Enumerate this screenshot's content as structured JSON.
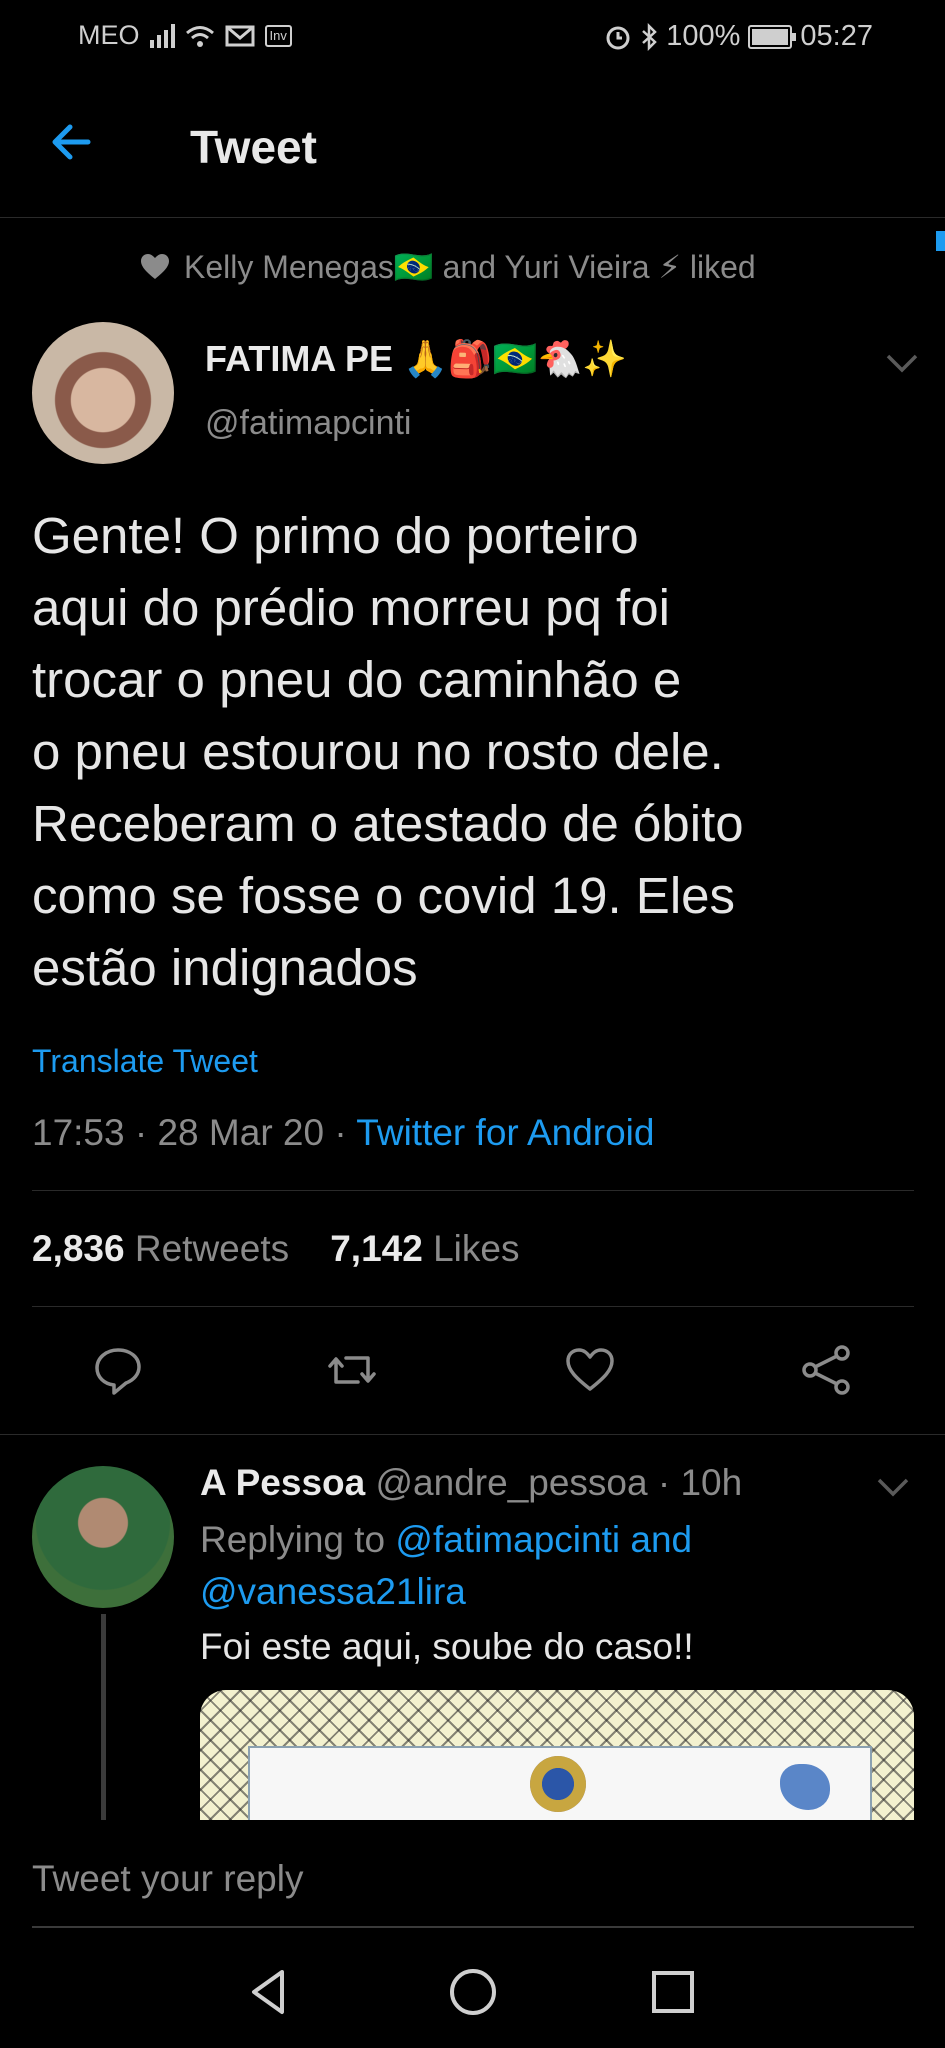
{
  "status_bar": {
    "carrier": "MEO",
    "badge_1": "Inv",
    "battery": "100%",
    "time": "05:27",
    "icons": [
      "signal-icon",
      "wifi-icon",
      "mail-icon",
      "alarm-icon",
      "bluetooth-icon",
      "battery-icon"
    ]
  },
  "header": {
    "title": "Tweet",
    "back_icon": "arrow-left-icon"
  },
  "social_context": {
    "text": "Kelly Menegas🇧🇷 and Yuri Vieira ⚡ liked"
  },
  "tweet": {
    "author_name": "FATIMA PE 🙏🎒🇧🇷🐔✨",
    "author_handle": "@fatimapcinti",
    "lines": [
      "Gente! O primo do porteiro",
      "aqui do prédio morreu pq foi",
      "trocar o pneu do caminhão e",
      "o pneu estourou no rosto dele.",
      "Receberam o atestado de óbito",
      "como se fosse o covid 19. Eles",
      "estão indignados"
    ],
    "translate_label": "Translate Tweet",
    "time": "17:53",
    "date": "28 Mar 20",
    "source": "Twitter for Android",
    "retweets_count": "2,836",
    "retweets_label": "Retweets",
    "likes_count": "7,142",
    "likes_label": "Likes"
  },
  "reply": {
    "author_name": "A Pessoa",
    "author_handle": "@andre_pessoa",
    "age": "10h",
    "replying_prefix": "Replying to",
    "replying_to_1": "@fatimapcinti",
    "replying_and": "and",
    "replying_to_2": "@vanessa21lira",
    "text": "Foi este aqui, soube do caso!!"
  },
  "reply_bar": {
    "placeholder": "Tweet your reply"
  },
  "colors": {
    "accent": "#1d9bf0",
    "background": "#000000",
    "muted": "#8b8b8b"
  }
}
